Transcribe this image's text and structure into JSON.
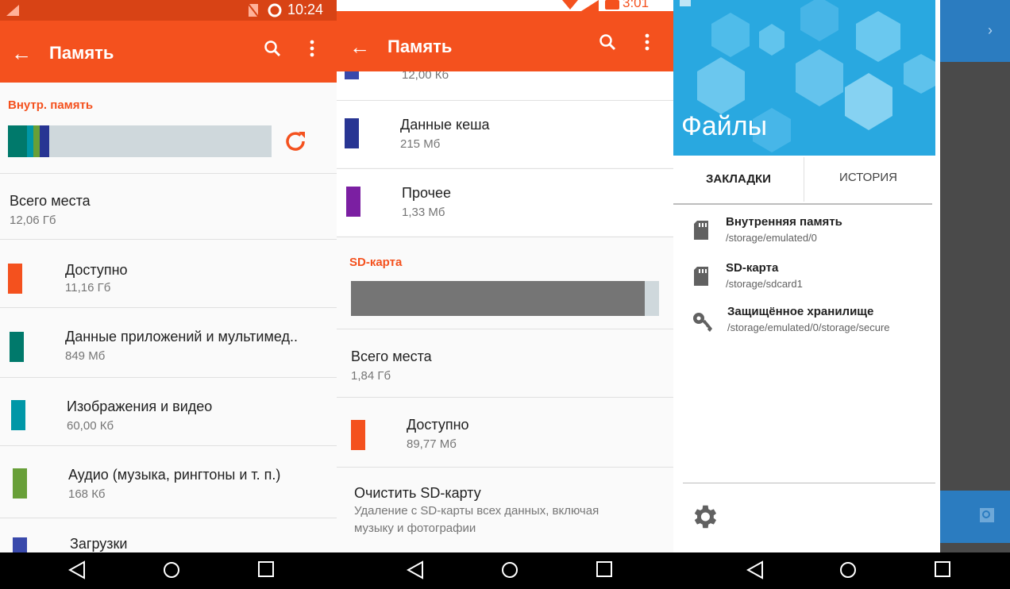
{
  "panel1": {
    "status": {
      "time": "10:24"
    },
    "appbar": {
      "title": "Память"
    },
    "internal": {
      "section_label": "Внутр. память",
      "total_title": "Всего места",
      "total_value": "12,06 Гб",
      "items": [
        {
          "title": "Доступно",
          "value": "11,16 Гб",
          "color": "#f4511e"
        },
        {
          "title": "Данные приложений и мультимед..",
          "value": "849 Мб",
          "color": "#00796b"
        },
        {
          "title": "Изображения и видео",
          "value": "60,00 Кб",
          "color": "#0097a7"
        },
        {
          "title": "Аудио (музыка, рингтоны и т. п.)",
          "value": "168 Кб",
          "color": "#689f38"
        },
        {
          "title": "Загрузки",
          "value": "",
          "color": "#3949ab"
        }
      ]
    }
  },
  "panel2": {
    "status": {
      "time": "3:01"
    },
    "appbar": {
      "title": "Память"
    },
    "partial_value": "12,00 Кб",
    "items": [
      {
        "title": "Данные кеша",
        "value": "215 Мб",
        "color": "#283593"
      },
      {
        "title": "Прочее",
        "value": "1,33 Мб",
        "color": "#7b1fa2"
      }
    ],
    "sd": {
      "section_label": "SD-карта",
      "total_title": "Всего места",
      "total_value": "1,84 Гб",
      "available_title": "Доступно",
      "available_value": "89,77 Мб",
      "clear_title": "Очистить SD-карту",
      "clear_desc_1": "Удаление с SD-карты всех данных, включая",
      "clear_desc_2": "музыку и фотографии"
    }
  },
  "panel3": {
    "drawer_title": "Файлы",
    "tabs": [
      "ЗАКЛАДКИ",
      "ИСТОРИЯ"
    ],
    "bookmarks": [
      {
        "title": "Внутренняя память",
        "path": "/storage/emulated/0",
        "icon": "sd-card-icon"
      },
      {
        "title": "SD-карта",
        "path": "/storage/sdcard1",
        "icon": "sd-card-icon"
      },
      {
        "title": "Защищённое хранилище",
        "path": "/storage/emulated/0/storage/secure",
        "icon": "key-icon"
      }
    ]
  },
  "colors": {
    "accent": "#f4511e",
    "drawer_header": "#29a8e0",
    "navbar": "#000000"
  }
}
